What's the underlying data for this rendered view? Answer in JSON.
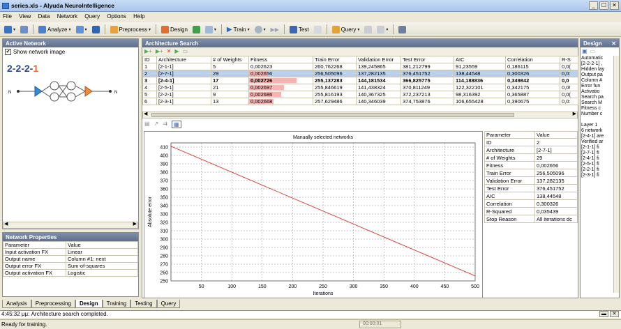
{
  "window": {
    "title": "series.xls - Alyuda NeuroIntelligence",
    "controls": [
      "_",
      "☐",
      "✕"
    ]
  },
  "menu": [
    "File",
    "View",
    "Data",
    "Network",
    "Query",
    "Options",
    "Help"
  ],
  "toolbar": {
    "analyze": "Analyze",
    "preprocess": "Preprocess",
    "design": "Design",
    "train": "Train",
    "test": "Test",
    "query": "Query"
  },
  "active_network": {
    "header": "Active Network",
    "show_image_label": "Show network image",
    "arch_label": "2-2-2-",
    "arch_last": "1",
    "input_node_label": "N",
    "output_node_label": "N"
  },
  "network_properties": {
    "header": "Network Properties",
    "columns": [
      "Parameter",
      "Value"
    ],
    "rows": [
      [
        "Input activation FX",
        "Linear"
      ],
      [
        "Output name",
        "Column #1: next"
      ],
      [
        "Output error FX",
        "Sum-of-squares"
      ],
      [
        "Output activation FX",
        "Logistic"
      ]
    ]
  },
  "arch_search": {
    "header": "Architecture Search",
    "columns": [
      "ID",
      "Architecture",
      "# of Weights",
      "Fitness",
      "Train Error",
      "Validation Error",
      "Test Error",
      "AIC",
      "Correlation",
      "R-S"
    ],
    "rows": [
      {
        "id": "1",
        "arch": "[2-1-1]",
        "weights": "5",
        "fitness": "0,002623",
        "train": "260,762268",
        "valid": "139,245865",
        "test": "381,212799",
        "aic": "91,23559",
        "corr": "0,186115",
        "rs": "0,0(",
        "fit_frac": 0.0
      },
      {
        "id": "2",
        "arch": "[2-7-1]",
        "weights": "29",
        "fitness": "0,002656",
        "train": "256,505096",
        "valid": "137,282135",
        "test": "376,451752",
        "aic": "138,44548",
        "corr": "0,300326",
        "rs": "0,0:",
        "fit_frac": 0.3
      },
      {
        "id": "3",
        "arch": "[2-4-1]",
        "weights": "17",
        "fitness": "0,002726",
        "train": "255,137283",
        "valid": "144,181534",
        "test": "366,825775",
        "aic": "114,188836",
        "corr": "0,349842",
        "rs": "0,0",
        "fit_frac": 0.75
      },
      {
        "id": "4",
        "arch": "[2-5-1]",
        "weights": "21",
        "fitness": "0,002697",
        "train": "255,846619",
        "valid": "141,438324",
        "test": "370,811249",
        "aic": "122,322101",
        "corr": "0,342175",
        "rs": "0,0!",
        "fit_frac": 0.55
      },
      {
        "id": "5",
        "arch": "[2-2-1]",
        "weights": "9",
        "fitness": "0,002686",
        "train": "255,816193",
        "valid": "140,367325",
        "test": "372,237213",
        "aic": "98,316392",
        "corr": "0,365887",
        "rs": "0,0(",
        "fit_frac": 0.5
      },
      {
        "id": "6",
        "arch": "[2-3-1]",
        "weights": "13",
        "fitness": "0,002668",
        "train": "257,629486",
        "valid": "140,346039",
        "test": "374,753876",
        "aic": "106,655428",
        "corr": "0,390675",
        "rs": "0,0:",
        "fit_frac": 0.38
      }
    ]
  },
  "chart_data": {
    "type": "line",
    "title": "Manually selected networks",
    "xlabel": "Iterations",
    "ylabel": "Absolute error",
    "xlim": [
      0,
      500
    ],
    "ylim": [
      250,
      415
    ],
    "xticks": [
      50,
      100,
      150,
      200,
      250,
      300,
      350,
      400,
      450,
      500
    ],
    "yticks": [
      250,
      260,
      270,
      280,
      290,
      300,
      310,
      320,
      330,
      340,
      350,
      360,
      370,
      380,
      390,
      400,
      410
    ],
    "grid": true,
    "series": [
      {
        "x": [
          0,
          500
        ],
        "y": [
          411,
          256
        ],
        "color": "#e0312b"
      }
    ]
  },
  "selected_params": {
    "columns": [
      "Parameter",
      "Value"
    ],
    "rows": [
      [
        "ID",
        "2"
      ],
      [
        "Architecture",
        "[2-7-1]"
      ],
      [
        "# of Weights",
        "29"
      ],
      [
        "Fitness",
        "0,002656"
      ],
      [
        "Train Error",
        "256,505096"
      ],
      [
        "Validation Error",
        "137,282135"
      ],
      [
        "Test Error",
        "376,451752"
      ],
      [
        "AIC",
        "138,44548"
      ],
      [
        "Correlation",
        "0,300326"
      ],
      [
        "R-Squared",
        "0,035439"
      ],
      [
        "Stop Reason",
        "All iterations dc"
      ]
    ]
  },
  "design_pane": {
    "header": "Design",
    "lines": [
      "Automatic",
      "[2-2-2-1] ,",
      "Hidden lay",
      "Output pa",
      "Column #",
      "Error fun",
      "Activatio",
      "Search pa",
      "Search M",
      "Fitness c",
      "Number c",
      "",
      "Layer 1",
      "6 network",
      "[2-4-1] are",
      "Verified ar",
      "[2-1-1] fi",
      "[2-7-1] fi",
      "[2-4-1] fi",
      "[2-5-1] fi",
      "[2-2-1] fi",
      "[2-3-1] fi"
    ]
  },
  "bottom_tabs": [
    "Analysis",
    "Preprocessing",
    "Design",
    "Training",
    "Testing",
    "Query"
  ],
  "active_tab": "Design",
  "log_line": "4:45:32 μμ: Architecture search completed.",
  "status": {
    "text": "Ready for training.",
    "timer": "00:00:01"
  },
  "colors": {
    "accent": "#e66b2e",
    "selection": "#b9d1ec",
    "fitness_bar": "#f5b3b3",
    "chart_line": "#e0312b"
  }
}
